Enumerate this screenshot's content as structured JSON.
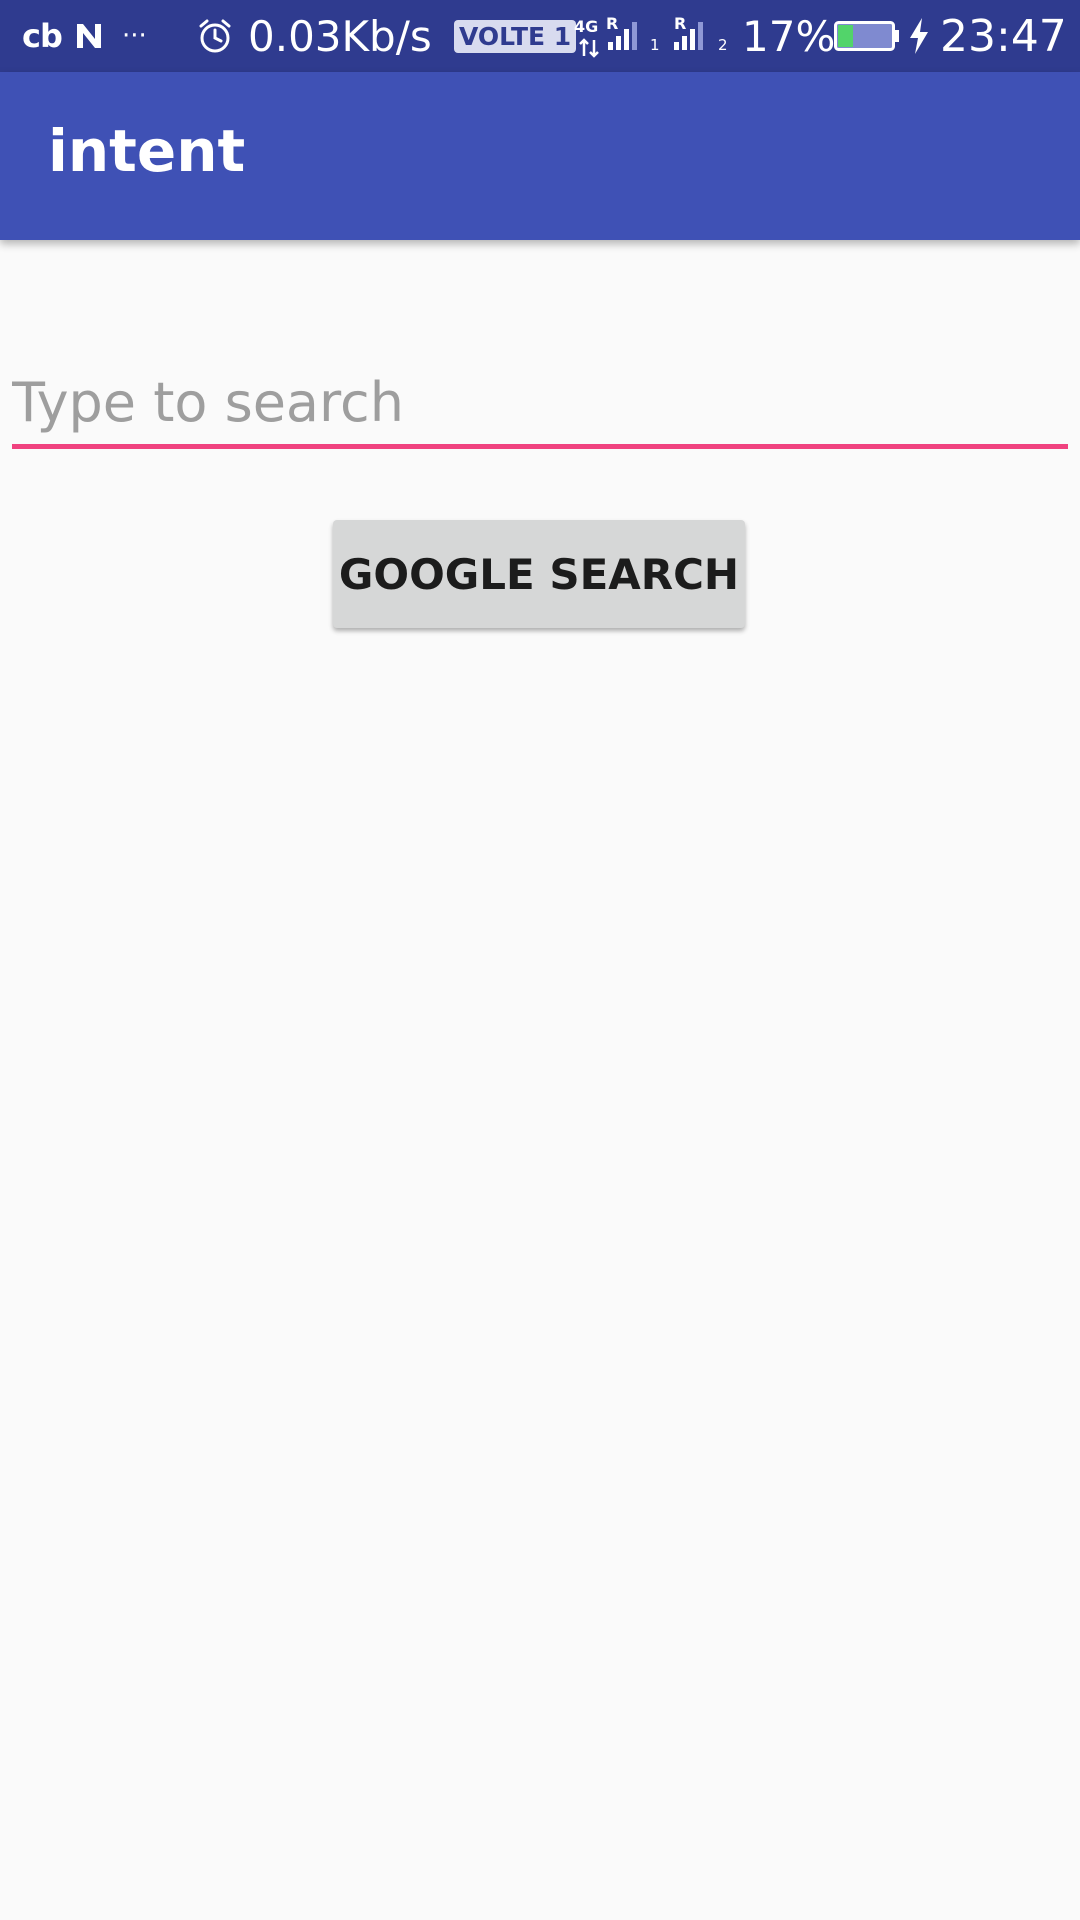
{
  "status_bar": {
    "carrier_badge": "cb",
    "more_indicator": "···",
    "network_speed": "0.03Kb/s",
    "volte_badge": "VOLTE 1",
    "network_type": "4G",
    "roaming_1": "R",
    "sim_1": "1",
    "roaming_2": "R",
    "sim_2": "2",
    "battery_percent": "17%",
    "battery_level": 0.17,
    "time": "23:47",
    "icons": [
      "n-icon",
      "alarm-icon",
      "signal-icon",
      "battery-icon",
      "charging-icon"
    ]
  },
  "app_bar": {
    "title": "intent"
  },
  "search": {
    "value": "",
    "placeholder": "Type to search"
  },
  "actions": {
    "google_search_label": "GOOGLE SEARCH"
  },
  "colors": {
    "status_bar": "#2f3b8f",
    "primary": "#3f51b5",
    "accent": "#f0427f",
    "background": "#fafafa",
    "button": "#d6d7d7"
  }
}
